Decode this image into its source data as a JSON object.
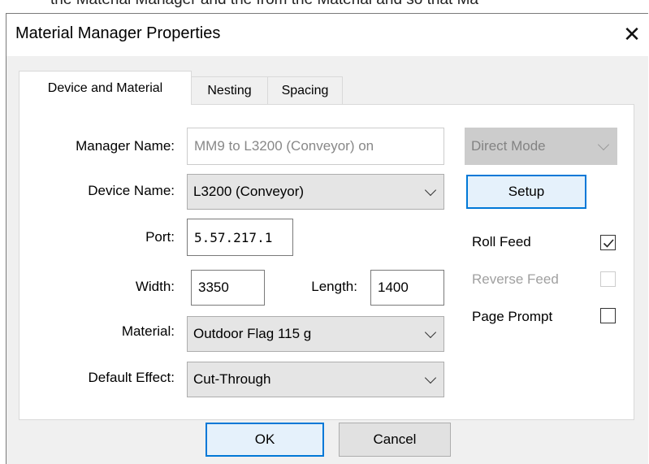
{
  "background_text": "the Material Manager and the from the Material and so that Ma",
  "window": {
    "title": "Material Manager Properties",
    "close_glyph": "✕"
  },
  "tabs": [
    {
      "label": "Device and Material",
      "active": true
    },
    {
      "label": "Nesting",
      "active": false
    },
    {
      "label": "Spacing",
      "active": false
    }
  ],
  "form": {
    "manager_name_label": "Manager Name:",
    "manager_name_value": "MM9 to L3200 (Conveyor) on",
    "mode_value": "Direct Mode",
    "device_name_label": "Device Name:",
    "device_name_value": "L3200 (Conveyor)",
    "setup_label": "Setup",
    "port_label": "Port:",
    "port_value": "5.57.217.1",
    "width_label": "Width:",
    "width_value": "3350",
    "length_label": "Length:",
    "length_value": "1400",
    "material_label": "Material:",
    "material_value": "Outdoor Flag 115 g",
    "default_effect_label": "Default Effect:",
    "default_effect_value": "Cut-Through",
    "roll_feed_label": "Roll Feed",
    "roll_feed_checked": true,
    "reverse_feed_label": "Reverse Feed",
    "reverse_feed_checked": false,
    "page_prompt_label": "Page Prompt",
    "page_prompt_checked": false
  },
  "buttons": {
    "ok_label": "OK",
    "cancel_label": "Cancel"
  },
  "colors": {
    "focus_border": "#0078d7",
    "dialog_bg": "#f0f0f0"
  }
}
